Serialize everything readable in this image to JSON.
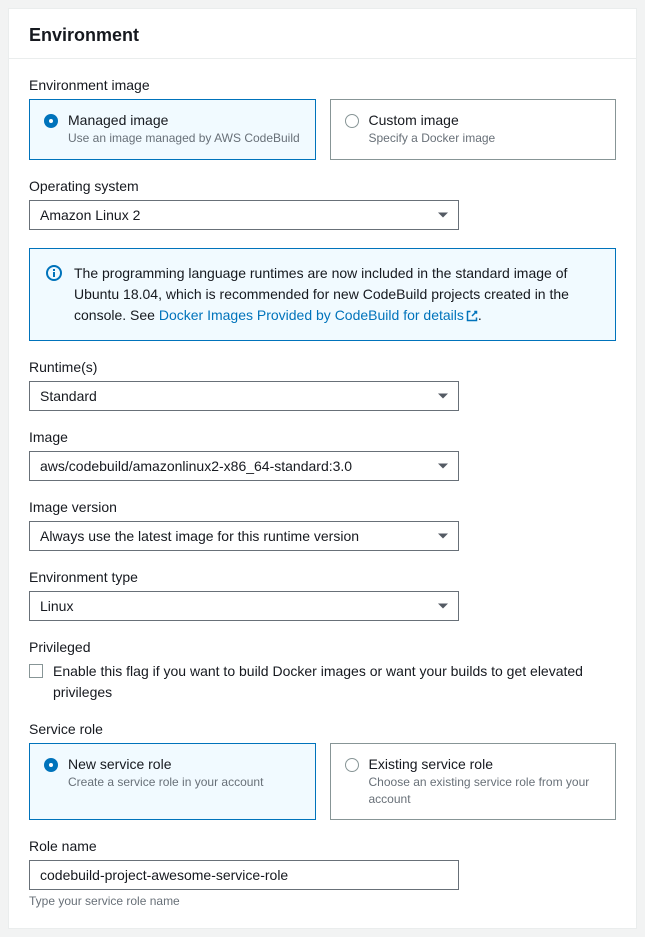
{
  "panel": {
    "title": "Environment"
  },
  "env_image": {
    "label": "Environment image",
    "managed": {
      "title": "Managed image",
      "desc": "Use an image managed by AWS CodeBuild"
    },
    "custom": {
      "title": "Custom image",
      "desc": "Specify a Docker image"
    },
    "selected": "managed"
  },
  "os": {
    "label": "Operating system",
    "value": "Amazon Linux 2"
  },
  "info": {
    "text_a": "The programming language runtimes are now included in the standard image of Ubuntu 18.04, which is recommended for new CodeBuild projects created in the console. See ",
    "link": "Docker Images Provided by CodeBuild for details",
    "text_b": "."
  },
  "runtime": {
    "label": "Runtime(s)",
    "value": "Standard"
  },
  "image": {
    "label": "Image",
    "value": "aws/codebuild/amazonlinux2-x86_64-standard:3.0"
  },
  "image_version": {
    "label": "Image version",
    "value": "Always use the latest image for this runtime version"
  },
  "env_type": {
    "label": "Environment type",
    "value": "Linux"
  },
  "privileged": {
    "label": "Privileged",
    "checkbox_label": "Enable this flag if you want to build Docker images or want your builds to get elevated privileges",
    "checked": false
  },
  "service_role": {
    "label": "Service role",
    "new_role": {
      "title": "New service role",
      "desc": "Create a service role in your account"
    },
    "existing_role": {
      "title": "Existing service role",
      "desc": "Choose an existing service role from your account"
    },
    "selected": "new_role"
  },
  "role_name": {
    "label": "Role name",
    "value": "codebuild-project-awesome-service-role",
    "hint": "Type your service role name"
  }
}
